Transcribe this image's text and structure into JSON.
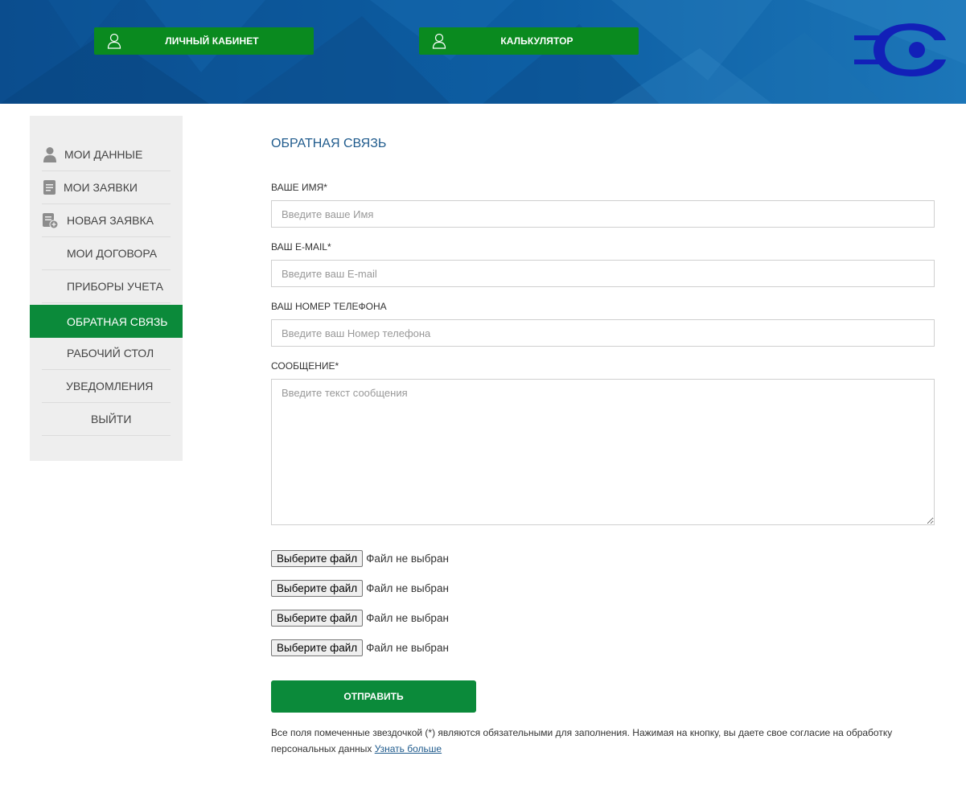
{
  "header": {
    "cabinet_button": "ЛИЧНЫЙ КАБИНЕТ",
    "calculator_button": "КАЛЬКУЛЯТОР",
    "accent_color": "#0a8a1f",
    "background_color": "#0a4e8c"
  },
  "sidebar": {
    "items": [
      {
        "label": "МОИ ДАННЫЕ",
        "icon": "user-icon"
      },
      {
        "label": "МОИ ЗАЯВКИ",
        "icon": "document-icon"
      },
      {
        "label": "НОВАЯ ЗАЯВКА",
        "icon": "document-add-icon"
      },
      {
        "label": "МОИ ДОГОВОРА"
      },
      {
        "label": "ПРИБОРЫ УЧЕТА"
      },
      {
        "label": "ОБРАТНАЯ СВЯЗЬ",
        "active": true
      },
      {
        "label": "РАБОЧИЙ СТОЛ"
      },
      {
        "label": "УВЕДОМЛЕНИЯ"
      },
      {
        "label": "ВЫЙТИ"
      }
    ]
  },
  "form": {
    "title": "ОБРАТНАЯ СВЯЗЬ",
    "name_label": "ВАШЕ ИМЯ*",
    "name_placeholder": "Введите ваше Имя",
    "email_label": "ВАШ E-MAIL*",
    "email_placeholder": "Введите ваш E-mail",
    "phone_label": "ВАШ НОМЕР ТЕЛЕФОНА",
    "phone_placeholder": "Введите ваш Номер телефона",
    "message_label": "СООБЩЕНИЕ*",
    "message_placeholder": "Введите текст сообщения",
    "files": [
      {
        "button": "Выберите файл",
        "status": "Файл не выбран"
      },
      {
        "button": "Выберите файл",
        "status": "Файл не выбран"
      },
      {
        "button": "Выберите файл",
        "status": "Файл не выбран"
      },
      {
        "button": "Выберите файл",
        "status": "Файл не выбран"
      }
    ],
    "submit_label": "ОТПРАВИТЬ",
    "note_text": "Все поля помеченные звездочкой (*) являются обязательными для заполнения. Нажимая на кнопку, вы даете свое согласие на обработку персональных данных ",
    "note_link": "Узнать больше"
  }
}
